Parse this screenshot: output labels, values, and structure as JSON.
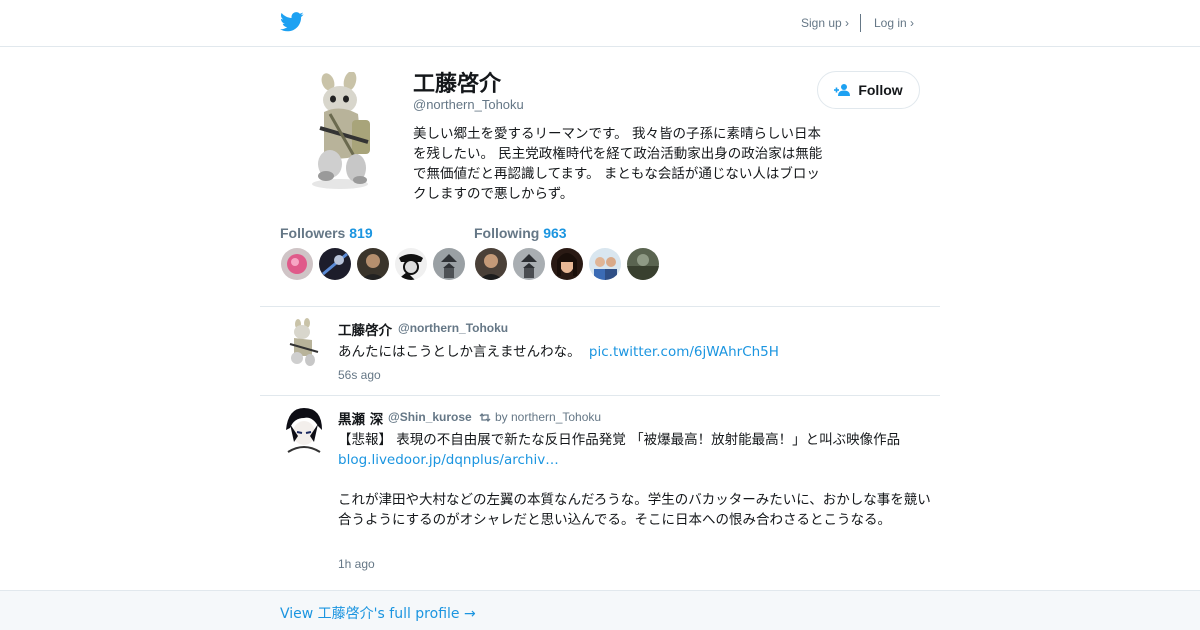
{
  "header": {
    "signup_label": "Sign up ›",
    "login_label": "Log in ›"
  },
  "profile": {
    "name": "工藤啓介",
    "handle": "@northern_Tohoku",
    "bio": "美しい郷土を愛するリーマンです。 我々皆の子孫に素晴らしい日本を残したい。 民主党政権時代を経て政治活動家出身の政治家は無能で無価値だと再認識してます。 まともな会話が通じない人はブロックしますので悪しからず。",
    "follow_label": "Follow",
    "followers_label": "Followers",
    "followers_count": "819",
    "following_label": "Following",
    "following_count": "963"
  },
  "tweets": [
    {
      "name": "工藤啓介",
      "handle": "@northern_Tohoku",
      "text": "あんたにはこうとしか言えませんわな。",
      "link": "pic.twitter.com/6jWAhrCh5H",
      "time": "56s ago"
    },
    {
      "name": "黒瀬 深",
      "handle": "@Shin_kurose",
      "retweet_by": "by northern_Tohoku",
      "text1": "【悲報】 表現の不自由展で新たな反日作品発覚 「被爆最高！放射能最高！」と叫ぶ映像作品",
      "link": "blog.livedoor.jp/dqnplus/archiv…",
      "text2": "これが津田や大村などの左翼の本質なんだろうな。学生のバカッターみたいに、おかしな事を競い合うようにするのがオシャレだと思い込んでる。そこに日本への恨み合わさるとこうなる。",
      "time": "1h ago"
    }
  ],
  "footer": {
    "full_profile_label": "View 工藤啓介's full profile →"
  },
  "colors": {
    "brand": "#1da1f2",
    "link": "#1b95e0",
    "muted": "#657786"
  }
}
